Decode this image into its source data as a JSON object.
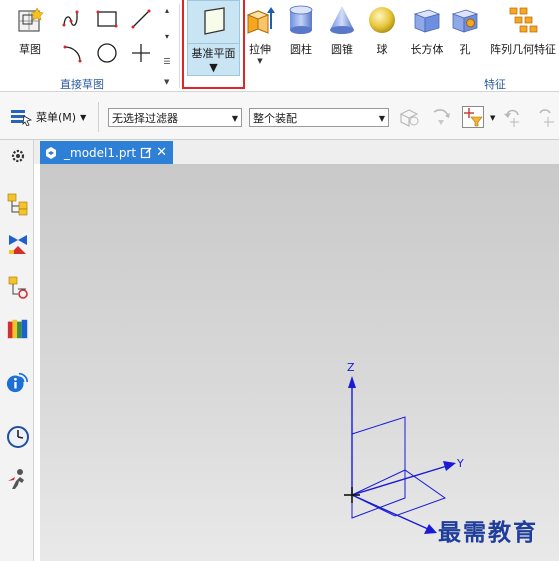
{
  "ribbon": {
    "sketch_label": "草图",
    "direct_sketch_group_label": "直接草图",
    "datum_plane_label": "基准平面",
    "extrude_label": "拉伸",
    "cylinder_label": "圆柱",
    "cone_label": "圆锥",
    "sphere_label": "球",
    "block_label": "长方体",
    "hole_label": "孔",
    "pattern_label": "阵列几何特征",
    "feature_group_label": "特征"
  },
  "toolbar2": {
    "menu_label": "菜单(M)",
    "filter_value": "无选择过滤器",
    "assembly_scope_value": "整个装配"
  },
  "document_tab": {
    "name": "_model1.prt"
  },
  "viewport": {
    "axis_z": "Z",
    "axis_y": "Y",
    "axis_color": "#1a1ad6"
  },
  "watermark": {
    "text": "最需教育"
  },
  "colors": {
    "tab_blue": "#2e7fd6",
    "highlight_red": "#e0242a",
    "selected_button_bg": "#c9e4f3",
    "group_label_blue": "#2a5a9a"
  }
}
